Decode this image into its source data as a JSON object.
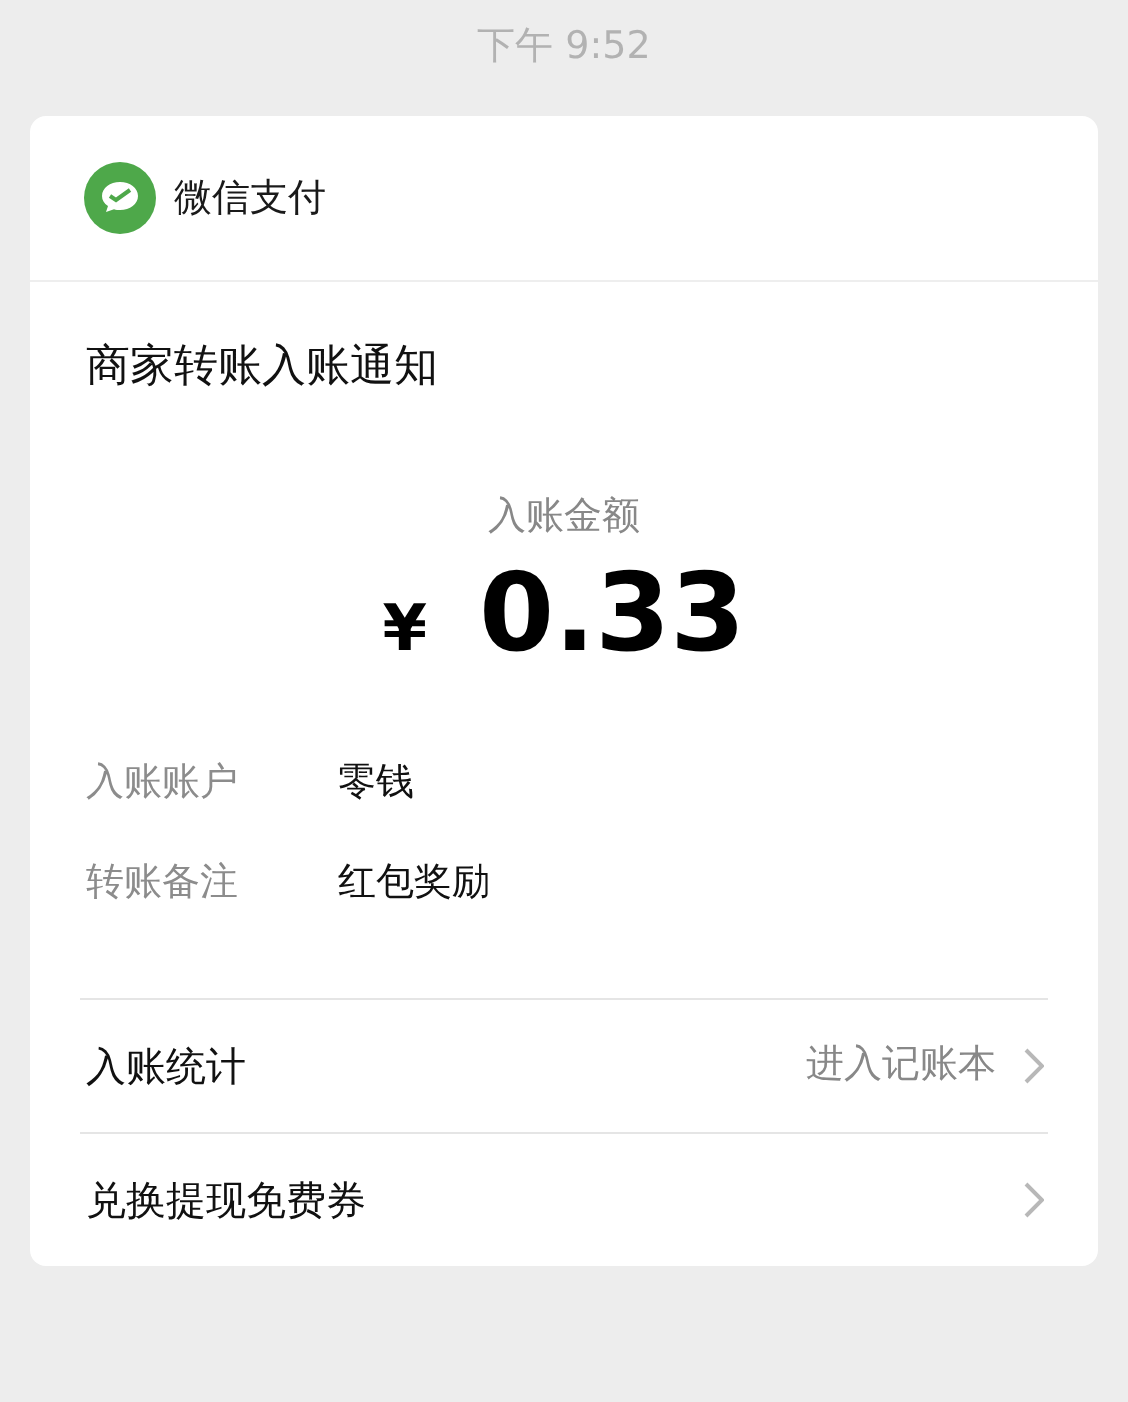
{
  "status_time": "下午 9:52",
  "card": {
    "brand": "微信支付",
    "title": "商家转账入账通知",
    "amount_label": "入账金额",
    "currency": "¥",
    "amount": "0.33",
    "details": [
      {
        "label": "入账账户",
        "value": "零钱"
      },
      {
        "label": "转账备注",
        "value": "红包奖励"
      }
    ],
    "actions": [
      {
        "label": "入账统计",
        "hint": "进入记账本"
      },
      {
        "label": "兑换提现免费券"
      }
    ]
  }
}
